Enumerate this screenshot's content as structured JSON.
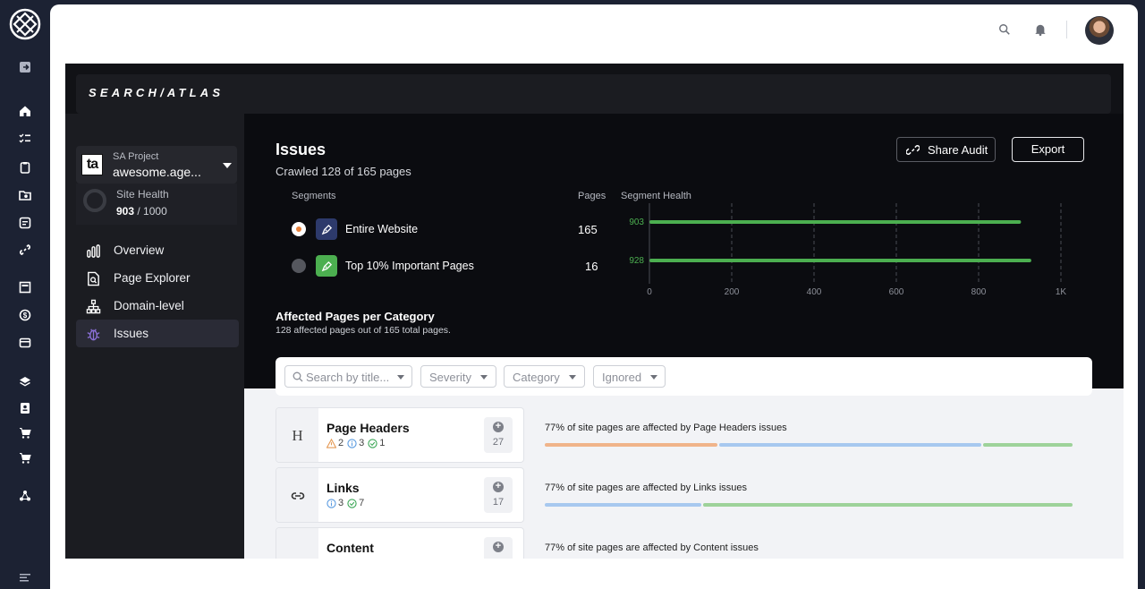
{
  "header": {
    "brand": "SEARCH/ATLAS"
  },
  "project": {
    "label": "SA Project",
    "name": "awesome.age...",
    "logo_text": "ta"
  },
  "site_health": {
    "label": "Site Health",
    "value": "903",
    "max": "/ 1000"
  },
  "nav": [
    {
      "label": "Overview",
      "icon": "bar-chart-icon",
      "active": false
    },
    {
      "label": "Page Explorer",
      "icon": "page-search-icon",
      "active": false
    },
    {
      "label": "Domain-level",
      "icon": "sitemap-icon",
      "active": false
    },
    {
      "label": "Issues",
      "icon": "bug-icon",
      "active": true
    }
  ],
  "issues": {
    "title": "Issues",
    "crawled": "Crawled 128 of 165 pages",
    "share_label": "Share Audit",
    "export_label": "Export"
  },
  "segments": {
    "col_segments": "Segments",
    "col_pages": "Pages",
    "col_health": "Segment Health",
    "rows": [
      {
        "name": "Entire Website",
        "pages": "165",
        "health": "903",
        "selected": true,
        "icon_bg": "#2d3a6b"
      },
      {
        "name": "Top 10% Important Pages",
        "pages": "16",
        "health": "928",
        "selected": false,
        "icon_bg": "#4caf50"
      }
    ]
  },
  "chart_data": {
    "type": "bar",
    "orientation": "horizontal",
    "categories": [
      "Entire Website",
      "Top 10% Important Pages"
    ],
    "values": [
      903,
      928
    ],
    "xlim": [
      0,
      1000
    ],
    "xticks": [
      "0",
      "200",
      "400",
      "600",
      "800",
      "1K"
    ],
    "xtick_values": [
      0,
      200,
      400,
      600,
      800,
      1000
    ],
    "grid": "vertical dashed",
    "bar_color": "#4caf50"
  },
  "affected": {
    "title": "Affected Pages per Category",
    "subtitle": "128 affected pages out of 165 total pages."
  },
  "filters": {
    "search_placeholder": "Search by title...",
    "severity": "Severity",
    "category": "Category",
    "ignored": "Ignored"
  },
  "categories": [
    {
      "name": "Page Headers",
      "icon_text": "H",
      "warn": "2",
      "info": "3",
      "ok": "1",
      "count": "27",
      "desc": "77% of site pages are affected by Page Headers issues",
      "bars": [
        0.33,
        0.5,
        0.17
      ]
    },
    {
      "name": "Links",
      "icon_text": "",
      "warn": "",
      "info": "3",
      "ok": "7",
      "count": "17",
      "desc": "77% of site pages are affected by Links issues",
      "bars": [
        0.3,
        0.7
      ]
    },
    {
      "name": "Content",
      "icon_text": "",
      "count": "",
      "desc": "77% of site pages are affected by Content issues"
    }
  ],
  "colors": {
    "warn": "#f0b48a",
    "info": "#a7c8ef",
    "ok": "#9ed29a",
    "health_green": "#4caf50",
    "active_nav": "#2a2b36"
  }
}
